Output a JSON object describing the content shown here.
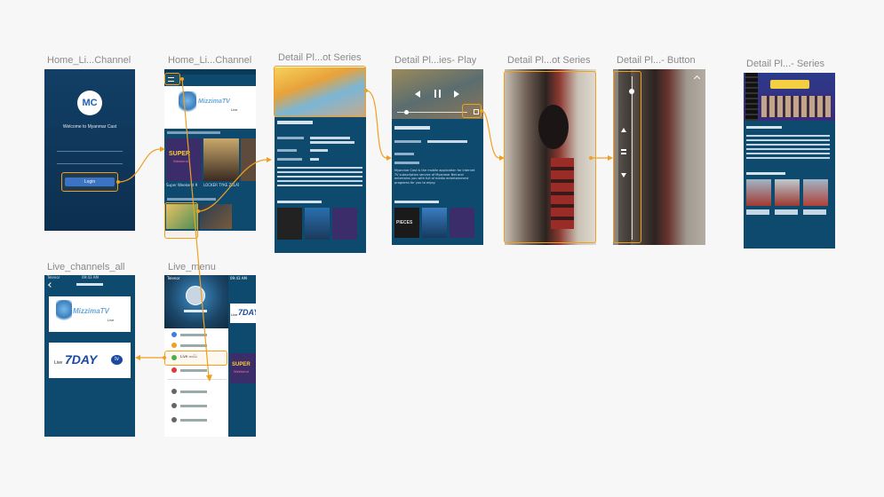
{
  "labels": {
    "s1": "Home_Li...Channel",
    "s2": "Home_Li...Channel",
    "s3": "Detail Pl...ot Series",
    "s4": "Detail Pl...ies- Play",
    "s5": "Detail Pl...ot Series",
    "s6": "Detail Pl...- Button",
    "s7": "Detail Pl...- Series",
    "s8": "Live_channels_all",
    "s9": "Live_menu"
  },
  "splash": {
    "logo_text": "MC",
    "welcome": "Welcome to Myanmar Cast",
    "login": "Login"
  },
  "home": {
    "status_time": "10:31 AM",
    "brand": "MizzimaTV",
    "brand_sub": "Live",
    "thumb_caption_1": "Super Weekend 9",
    "thumb_caption_2": "LOCKER TYKE ZELAT",
    "super_text": "SUPER",
    "weekend_text": "Weekend"
  },
  "detail": {
    "pieces_text": "PIECES",
    "info_text": "Myanmar Cast is the mobile application for internet TV subscription service of Myanmar Net and entertains you with full of media entertainment programs for you to enjoy."
  },
  "live_all": {
    "status_carrier": "Telenor",
    "status_time": "09:43 AM",
    "channel_1": "MizzimaTV",
    "channel_1_sub": "Live",
    "channel_2": "7DAY",
    "channel_2_prefix": "Live",
    "channel_2_suffix": "tv"
  },
  "live_menu": {
    "status_carrier": "Telenor",
    "status_time": "09:43 AM",
    "side_7day": "7DAY",
    "side_live": "Live",
    "side_super": "SUPER",
    "side_weekend": "Weekend",
    "live_item": "Live ထပ်မံ"
  },
  "colors": {
    "accent": "#f0a020",
    "screen_bg": "#0e4a6e",
    "button_blue": "#2d6fd0"
  }
}
